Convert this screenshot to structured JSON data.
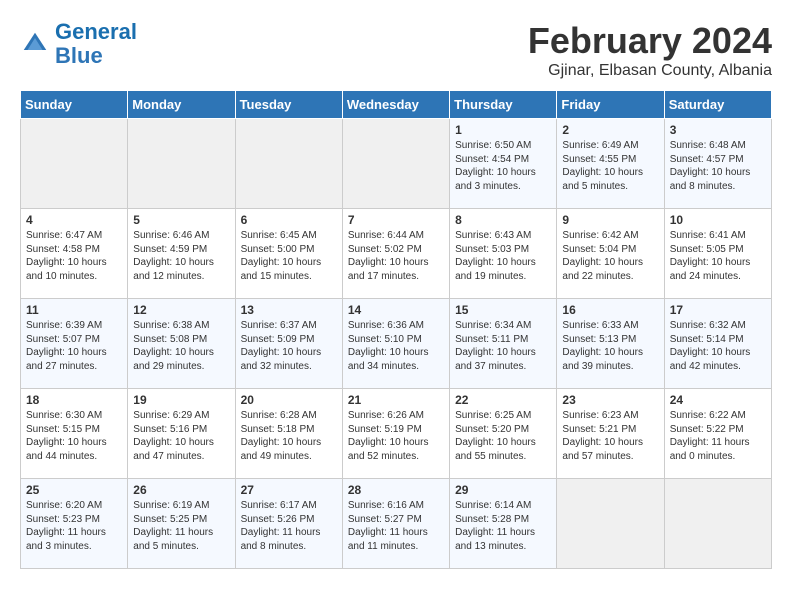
{
  "header": {
    "logo_line1": "General",
    "logo_line2": "Blue",
    "month": "February 2024",
    "location": "Gjinar, Elbasan County, Albania"
  },
  "weekdays": [
    "Sunday",
    "Monday",
    "Tuesday",
    "Wednesday",
    "Thursday",
    "Friday",
    "Saturday"
  ],
  "weeks": [
    [
      {
        "day": "",
        "info": ""
      },
      {
        "day": "",
        "info": ""
      },
      {
        "day": "",
        "info": ""
      },
      {
        "day": "",
        "info": ""
      },
      {
        "day": "1",
        "info": "Sunrise: 6:50 AM\nSunset: 4:54 PM\nDaylight: 10 hours\nand 3 minutes."
      },
      {
        "day": "2",
        "info": "Sunrise: 6:49 AM\nSunset: 4:55 PM\nDaylight: 10 hours\nand 5 minutes."
      },
      {
        "day": "3",
        "info": "Sunrise: 6:48 AM\nSunset: 4:57 PM\nDaylight: 10 hours\nand 8 minutes."
      }
    ],
    [
      {
        "day": "4",
        "info": "Sunrise: 6:47 AM\nSunset: 4:58 PM\nDaylight: 10 hours\nand 10 minutes."
      },
      {
        "day": "5",
        "info": "Sunrise: 6:46 AM\nSunset: 4:59 PM\nDaylight: 10 hours\nand 12 minutes."
      },
      {
        "day": "6",
        "info": "Sunrise: 6:45 AM\nSunset: 5:00 PM\nDaylight: 10 hours\nand 15 minutes."
      },
      {
        "day": "7",
        "info": "Sunrise: 6:44 AM\nSunset: 5:02 PM\nDaylight: 10 hours\nand 17 minutes."
      },
      {
        "day": "8",
        "info": "Sunrise: 6:43 AM\nSunset: 5:03 PM\nDaylight: 10 hours\nand 19 minutes."
      },
      {
        "day": "9",
        "info": "Sunrise: 6:42 AM\nSunset: 5:04 PM\nDaylight: 10 hours\nand 22 minutes."
      },
      {
        "day": "10",
        "info": "Sunrise: 6:41 AM\nSunset: 5:05 PM\nDaylight: 10 hours\nand 24 minutes."
      }
    ],
    [
      {
        "day": "11",
        "info": "Sunrise: 6:39 AM\nSunset: 5:07 PM\nDaylight: 10 hours\nand 27 minutes."
      },
      {
        "day": "12",
        "info": "Sunrise: 6:38 AM\nSunset: 5:08 PM\nDaylight: 10 hours\nand 29 minutes."
      },
      {
        "day": "13",
        "info": "Sunrise: 6:37 AM\nSunset: 5:09 PM\nDaylight: 10 hours\nand 32 minutes."
      },
      {
        "day": "14",
        "info": "Sunrise: 6:36 AM\nSunset: 5:10 PM\nDaylight: 10 hours\nand 34 minutes."
      },
      {
        "day": "15",
        "info": "Sunrise: 6:34 AM\nSunset: 5:11 PM\nDaylight: 10 hours\nand 37 minutes."
      },
      {
        "day": "16",
        "info": "Sunrise: 6:33 AM\nSunset: 5:13 PM\nDaylight: 10 hours\nand 39 minutes."
      },
      {
        "day": "17",
        "info": "Sunrise: 6:32 AM\nSunset: 5:14 PM\nDaylight: 10 hours\nand 42 minutes."
      }
    ],
    [
      {
        "day": "18",
        "info": "Sunrise: 6:30 AM\nSunset: 5:15 PM\nDaylight: 10 hours\nand 44 minutes."
      },
      {
        "day": "19",
        "info": "Sunrise: 6:29 AM\nSunset: 5:16 PM\nDaylight: 10 hours\nand 47 minutes."
      },
      {
        "day": "20",
        "info": "Sunrise: 6:28 AM\nSunset: 5:18 PM\nDaylight: 10 hours\nand 49 minutes."
      },
      {
        "day": "21",
        "info": "Sunrise: 6:26 AM\nSunset: 5:19 PM\nDaylight: 10 hours\nand 52 minutes."
      },
      {
        "day": "22",
        "info": "Sunrise: 6:25 AM\nSunset: 5:20 PM\nDaylight: 10 hours\nand 55 minutes."
      },
      {
        "day": "23",
        "info": "Sunrise: 6:23 AM\nSunset: 5:21 PM\nDaylight: 10 hours\nand 57 minutes."
      },
      {
        "day": "24",
        "info": "Sunrise: 6:22 AM\nSunset: 5:22 PM\nDaylight: 11 hours\nand 0 minutes."
      }
    ],
    [
      {
        "day": "25",
        "info": "Sunrise: 6:20 AM\nSunset: 5:23 PM\nDaylight: 11 hours\nand 3 minutes."
      },
      {
        "day": "26",
        "info": "Sunrise: 6:19 AM\nSunset: 5:25 PM\nDaylight: 11 hours\nand 5 minutes."
      },
      {
        "day": "27",
        "info": "Sunrise: 6:17 AM\nSunset: 5:26 PM\nDaylight: 11 hours\nand 8 minutes."
      },
      {
        "day": "28",
        "info": "Sunrise: 6:16 AM\nSunset: 5:27 PM\nDaylight: 11 hours\nand 11 minutes."
      },
      {
        "day": "29",
        "info": "Sunrise: 6:14 AM\nSunset: 5:28 PM\nDaylight: 11 hours\nand 13 minutes."
      },
      {
        "day": "",
        "info": ""
      },
      {
        "day": "",
        "info": ""
      }
    ]
  ]
}
